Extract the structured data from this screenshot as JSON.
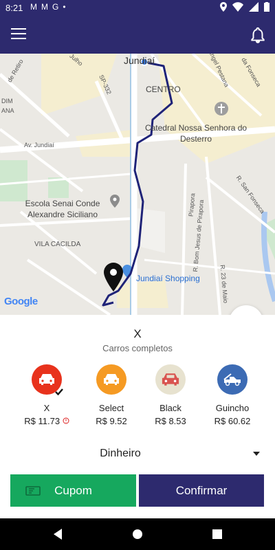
{
  "statusbar": {
    "time": "8:21",
    "notif_icons": [
      "M",
      "M",
      "G",
      "•"
    ]
  },
  "map": {
    "labels": {
      "city": "Jundiaí",
      "centro": "CENTRO",
      "cathedral": "Catedral Nossa Senhora do Desterro",
      "escola": "Escola Senai Conde Alexandre Siciliano",
      "vila": "VILA CACILDA",
      "shopping": "Jundiaí Shopping",
      "av_jundiai": "Av. Jundiaí",
      "sp332": "SP-332",
      "julho": "Julho",
      "retiro": "de Retiro",
      "dim": "DIM",
      "ana": "ANA",
      "rangel": "Rangel Pestana",
      "fonseca": "da Fonseca",
      "san_fonseca": "R. San Fonseca",
      "bom_jesus": "R. Bom Jesus de Pirapora",
      "maio": "R. 23 de Maio",
      "pirapora": "Pirapora"
    },
    "attribution": "Google"
  },
  "sheet": {
    "selected_name": "X",
    "selected_desc": "Carros completos",
    "categories": [
      {
        "label": "X",
        "price": "R$ 11.73",
        "color": "#e8321c",
        "icon": "car-icon",
        "selected": true
      },
      {
        "label": "Select",
        "price": "R$ 9.52",
        "color": "#f59a23",
        "icon": "car-icon"
      },
      {
        "label": "Black",
        "price": "R$ 8.53",
        "color": "#e7e2cf",
        "icon": "car-icon"
      },
      {
        "label": "Guincho",
        "price": "R$ 60.62",
        "color": "#3c6bb4",
        "icon": "tow-truck-icon"
      }
    ],
    "payment_method": "Dinheiro",
    "coupon_label": "Cupom",
    "confirm_label": "Confirmar"
  },
  "colors": {
    "primary": "#2d2a6e",
    "accent_green": "#16a85e",
    "route": "#1f2378"
  }
}
